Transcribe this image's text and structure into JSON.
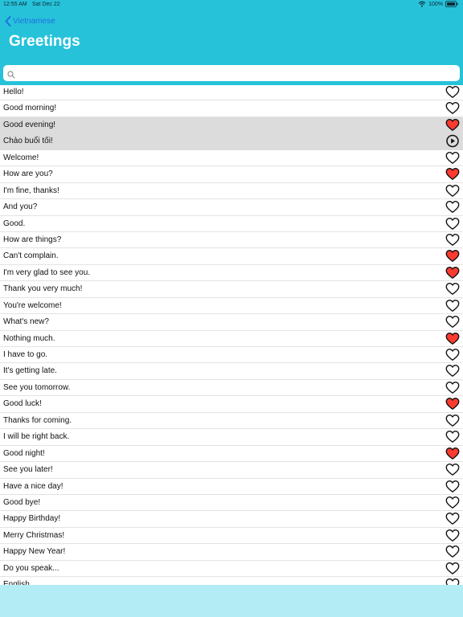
{
  "status": {
    "time": "12:55 AM",
    "date": "Sat Dec 22",
    "battery": "100%"
  },
  "nav": {
    "back_label": "Vietnamese",
    "title": "Greetings"
  },
  "search": {
    "value": "",
    "placeholder": ""
  },
  "colors": {
    "header": "#26c2da",
    "back_link": "#1f6fe0",
    "favorite": "#ff3b30",
    "selected_row": "#dcdcdc",
    "bottom_bar": "#b3ecf4"
  },
  "phrases": [
    {
      "text": "Hello!",
      "icon": "heart-outline-icon",
      "favorite": false
    },
    {
      "text": "Good morning!",
      "icon": "heart-outline-icon",
      "favorite": false
    },
    {
      "text": "Good evening!",
      "icon": "heart-filled-icon",
      "favorite": true,
      "selected": true
    },
    {
      "text": "Chào buổi tối!",
      "icon": "play-icon",
      "selected": true,
      "is_translation": true
    },
    {
      "text": "Welcome!",
      "icon": "heart-outline-icon",
      "favorite": false
    },
    {
      "text": "How are you?",
      "icon": "heart-filled-icon",
      "favorite": true
    },
    {
      "text": "I'm fine, thanks!",
      "icon": "heart-outline-icon",
      "favorite": false
    },
    {
      "text": "And you?",
      "icon": "heart-outline-icon",
      "favorite": false
    },
    {
      "text": "Good.",
      "icon": "heart-outline-icon",
      "favorite": false
    },
    {
      "text": "How are things?",
      "icon": "heart-outline-icon",
      "favorite": false
    },
    {
      "text": "Can't complain.",
      "icon": "heart-filled-icon",
      "favorite": true
    },
    {
      "text": "I'm very glad to see you.",
      "icon": "heart-filled-icon",
      "favorite": true
    },
    {
      "text": "Thank you very much!",
      "icon": "heart-outline-icon",
      "favorite": false
    },
    {
      "text": "You're welcome!",
      "icon": "heart-outline-icon",
      "favorite": false
    },
    {
      "text": "What's new?",
      "icon": "heart-outline-icon",
      "favorite": false
    },
    {
      "text": "Nothing much.",
      "icon": "heart-filled-icon",
      "favorite": true
    },
    {
      "text": "I have to go.",
      "icon": "heart-outline-icon",
      "favorite": false
    },
    {
      "text": "It's getting late.",
      "icon": "heart-outline-icon",
      "favorite": false
    },
    {
      "text": "See you tomorrow.",
      "icon": "heart-outline-icon",
      "favorite": false
    },
    {
      "text": "Good luck!",
      "icon": "heart-filled-icon",
      "favorite": true
    },
    {
      "text": "Thanks for coming.",
      "icon": "heart-outline-icon",
      "favorite": false
    },
    {
      "text": "I will be right back.",
      "icon": "heart-outline-icon",
      "favorite": false
    },
    {
      "text": "Good night!",
      "icon": "heart-filled-icon",
      "favorite": true
    },
    {
      "text": "See you later!",
      "icon": "heart-outline-icon",
      "favorite": false
    },
    {
      "text": "Have a nice day!",
      "icon": "heart-outline-icon",
      "favorite": false
    },
    {
      "text": "Good bye!",
      "icon": "heart-outline-icon",
      "favorite": false
    },
    {
      "text": "Happy Birthday!",
      "icon": "heart-outline-icon",
      "favorite": false
    },
    {
      "text": "Merry Christmas!",
      "icon": "heart-outline-icon",
      "favorite": false
    },
    {
      "text": "Happy New Year!",
      "icon": "heart-outline-icon",
      "favorite": false
    },
    {
      "text": "Do you speak...",
      "icon": "heart-outline-icon",
      "favorite": false
    },
    {
      "text": "English",
      "icon": "heart-outline-icon",
      "favorite": false
    }
  ]
}
